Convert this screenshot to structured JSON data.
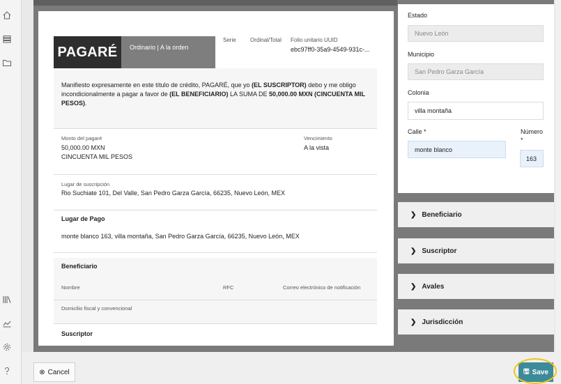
{
  "rail": {
    "icons": [
      "home-icon",
      "list-icon",
      "folder-icon",
      "books-icon",
      "chart-icon",
      "gear-icon",
      "help-icon"
    ]
  },
  "doc": {
    "title": "PAGARÉ",
    "subtitle": "Ordinario | A la orden",
    "serie_label": "Serie",
    "ordinal_label": "Ordinal/Total",
    "folio_label": "Folio unitario UUID",
    "folio_value": "ebc97ff0-35a9-4549-931c-...",
    "intro": {
      "p1": "Manifiesto expresamente en este título de crédito, PAGARÉ, que yo ",
      "b1": "(EL SUSCRIPTOR)",
      "p2": " debo y me obligo incondicionalmente a pagar a favor de ",
      "b2": "(EL BENEFICIARIO)",
      "p3": " LA SUMA DE ",
      "b3": "50,000.00 MXN (CINCUENTA MIL PESOS)",
      "p4": "."
    },
    "monto_label": "Monto del pagaré",
    "monto_value": "50,000.00 MXN",
    "monto_words": "CINCUENTA MIL PESOS",
    "vencimiento_label": "Vencimiento",
    "vencimiento_value": "A la vista",
    "lugar_susc_label": "Lugar de suscripción",
    "lugar_susc_value": "Rio Suchiate 101, Del Valle, San Pedro Garza García, 66235, Nuevo León, MEX",
    "lugar_pago_label": "Lugar de Pago",
    "lugar_pago_value": "monte blanco 163, villa montaña, San Pedro Garza García, 66235, Nuevo León, MEX",
    "beneficiario_label": "Beneficiario",
    "nombre_label": "Nombre",
    "rfc_label": "RFC",
    "correo_label": "Correo electrónico de notificación",
    "domicilio_label": "Domicilio fiscal y convencional",
    "suscriptor_label": "Suscriptor"
  },
  "form": {
    "estado_label": "Estado",
    "estado_value": "Nuevo León",
    "municipio_label": "Municipio",
    "municipio_value": "San Pedro Garza García",
    "colonia_label": "Colonia",
    "colonia_value": "villa montaña",
    "calle_label": "Calle *",
    "calle_value": "monte blanco",
    "numero_label": "Número",
    "numero_star": "*",
    "numero_value": "163"
  },
  "accordions": [
    "Beneficiario",
    "Suscriptor",
    "Avales",
    "Jurisdicción"
  ],
  "footer": {
    "cancel_label": "Cancel",
    "save_label": "Save"
  },
  "colors": {
    "save": "#3d8a9a",
    "highlight_ring": "#f0c419"
  }
}
